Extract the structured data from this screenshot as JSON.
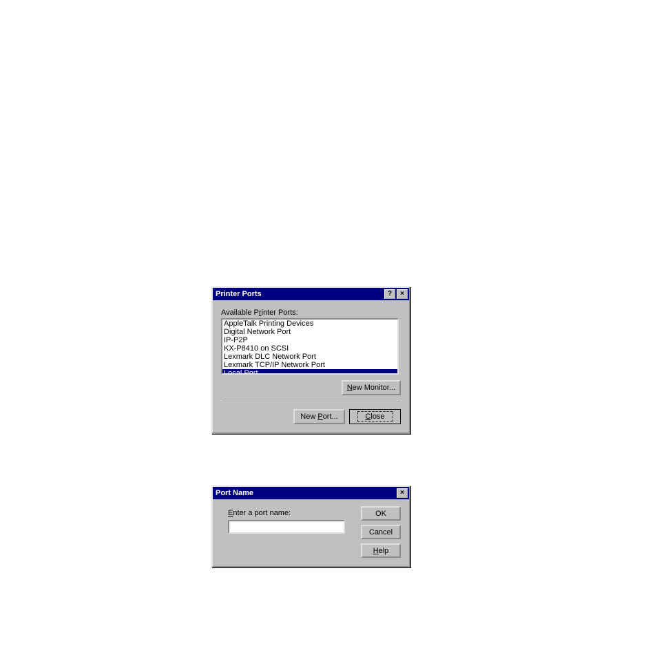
{
  "dialog1": {
    "title": "Printer Ports",
    "help_glyph": "?",
    "close_glyph": "×",
    "list_label_pre": "Available P",
    "list_label_u": "r",
    "list_label_post": "inter Ports:",
    "items": [
      "AppleTalk Printing Devices",
      "Digital Network Port",
      "IP-P2P",
      "KX-P8410 on SCSI",
      "Lexmark DLC Network Port",
      "Lexmark TCP/IP Network Port",
      "Local Port"
    ],
    "selected_index": 6,
    "new_monitor_u": "N",
    "new_monitor_post": "ew Monitor...",
    "new_port_pre": "New ",
    "new_port_u": "P",
    "new_port_post": "ort...",
    "close_u": "C",
    "close_post": "lose"
  },
  "dialog2": {
    "title": "Port Name",
    "close_glyph": "×",
    "label_u": "E",
    "label_post": "nter a port name:",
    "input_value": "",
    "ok": "OK",
    "cancel": "Cancel",
    "help_u": "H",
    "help_post": "elp"
  }
}
